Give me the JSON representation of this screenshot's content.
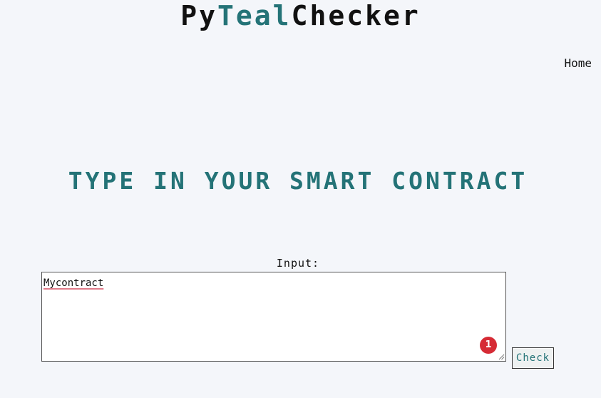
{
  "header": {
    "logo_part1": "Py",
    "logo_part2": "Teal",
    "logo_part3": "Checker"
  },
  "nav": {
    "home_label": "Home"
  },
  "main": {
    "headline": "TYPE IN YOUR SMART CONTRACT",
    "input_label": "Input:",
    "input_value": "Mycontract",
    "check_label": "Check",
    "badge_count": "1"
  },
  "colors": {
    "background": "#f4f6fa",
    "accent": "#247377",
    "badge": "#d62b35",
    "spell_underline": "#e07b8a"
  },
  "icons": {
    "resize": "resize-grip-icon"
  }
}
